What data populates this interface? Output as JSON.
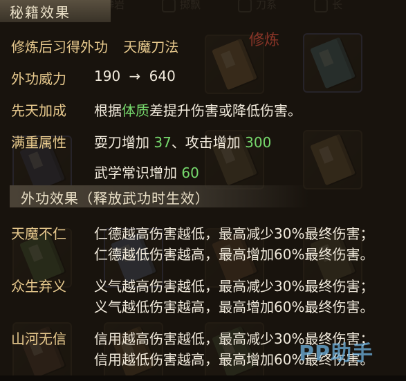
{
  "background": {
    "tabs": [
      "攀岩",
      "掷飘",
      "刀系",
      "长"
    ]
  },
  "header": {
    "title": "秘籍效果"
  },
  "cultivation": {
    "label": "修炼后习得外功",
    "skill": "天魔刀法",
    "stamp": "修炼"
  },
  "power": {
    "label": "外功威力",
    "from": "190",
    "arrow": "→",
    "to": "640"
  },
  "innate": {
    "label": "先天加成",
    "prefix": "根据",
    "attr": "体质",
    "suffix": "差提升伤害或降低伤害。"
  },
  "full_weight": {
    "label": "满重属性",
    "line1_a": "耍刀增加",
    "line1_a_val": "37",
    "line1_sep": "、攻击增加",
    "line1_b_val": "300",
    "line2_a": "武学常识增加",
    "line2_a_val": "60"
  },
  "effects_section": {
    "title": "外功效果（释放武功时生效）"
  },
  "effects": [
    {
      "label": "天魔不仁",
      "line1": "仁德越高伤害越低，最高减少30%最终伤害；",
      "line2": "仁德越低伤害越高，最高增加60%最终伤害。"
    },
    {
      "label": "众生弃义",
      "line1": "义气越高伤害越低，最高减少30%最终伤害；",
      "line2": "义气越低伤害越高，最高增加60%最终伤害。"
    },
    {
      "label": "山河无信",
      "line1": "信用越高伤害越低，最高减少30%最终伤害；",
      "line2": "信用越低伤害越高，最高增加60%最终伤害。"
    }
  ],
  "watermark": "PP助手",
  "colors": {
    "label": "#e7c98d",
    "highlight": "#76d86c",
    "text": "#f1eadc"
  }
}
